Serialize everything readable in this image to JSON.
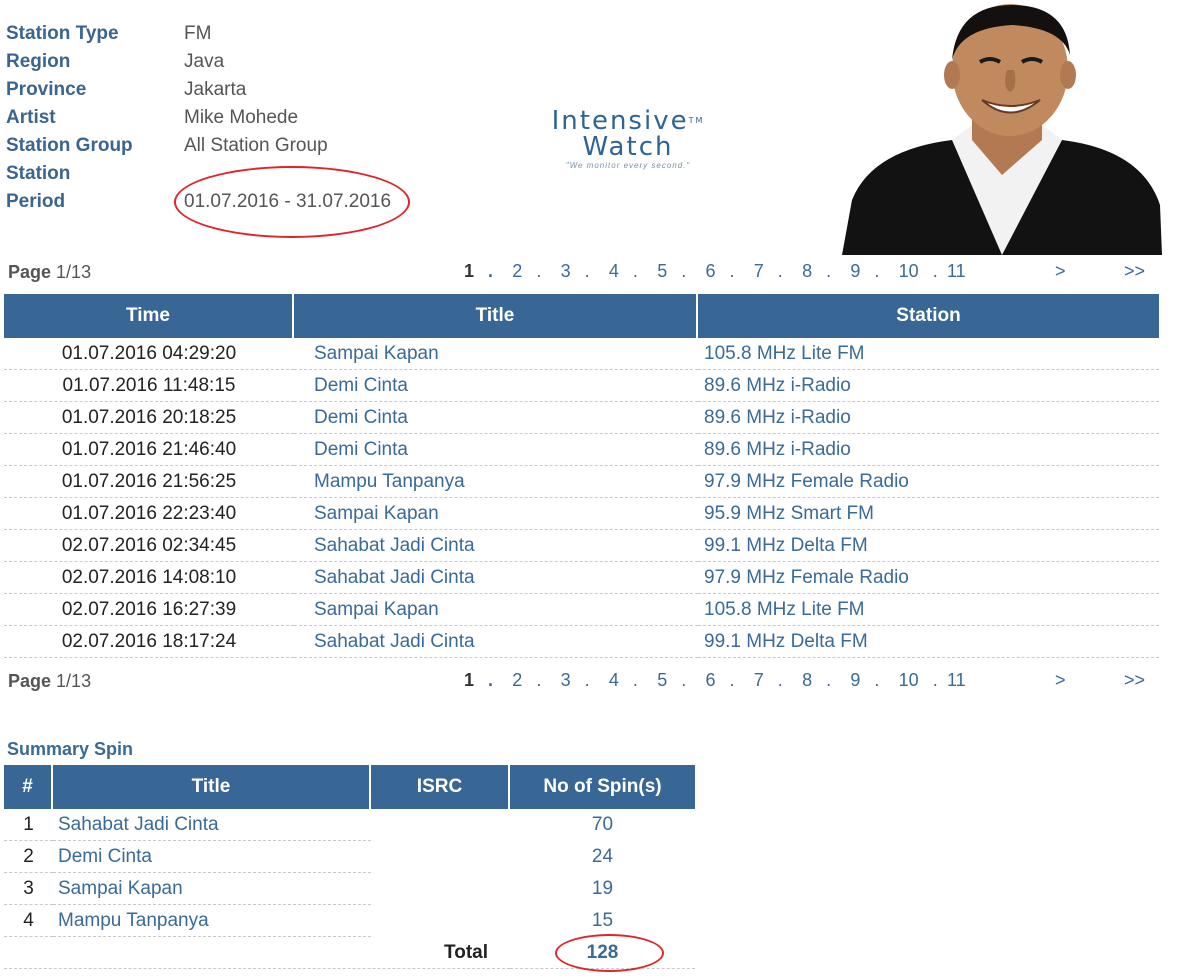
{
  "info": [
    {
      "label": "Station Type",
      "value": "FM"
    },
    {
      "label": "Region",
      "value": "Java"
    },
    {
      "label": "Province",
      "value": "Jakarta"
    },
    {
      "label": "Artist",
      "value": "Mike Mohede"
    },
    {
      "label": "Station Group",
      "value": "All Station Group"
    },
    {
      "label": "Station",
      "value": ""
    },
    {
      "label": "Period",
      "value": "01.07.2016 - 31.07.2016"
    }
  ],
  "logo": {
    "line1": "Intensive",
    "tm": "TM",
    "line2": "Watch",
    "tagline": "\"We monitor every second.\""
  },
  "pager": {
    "label": "Page",
    "current": "1/13",
    "pages": [
      "1",
      "2",
      "3",
      "4",
      "5",
      "6",
      "7",
      "8",
      "9",
      "10",
      "11"
    ],
    "separator": ".",
    "next": ">",
    "last": ">>"
  },
  "table": {
    "headers": [
      "Time",
      "Title",
      "Station"
    ],
    "rows": [
      {
        "time": "01.07.2016 04:29:20",
        "title": "Sampai Kapan",
        "station": "105.8 MHz Lite FM"
      },
      {
        "time": "01.07.2016 11:48:15",
        "title": "Demi Cinta",
        "station": "89.6 MHz i-Radio"
      },
      {
        "time": "01.07.2016 20:18:25",
        "title": "Demi Cinta",
        "station": "89.6 MHz i-Radio"
      },
      {
        "time": "01.07.2016 21:46:40",
        "title": "Demi Cinta",
        "station": "89.6 MHz i-Radio"
      },
      {
        "time": "01.07.2016 21:56:25",
        "title": "Mampu Tanpanya",
        "station": "97.9 MHz Female Radio"
      },
      {
        "time": "01.07.2016 22:23:40",
        "title": "Sampai Kapan",
        "station": "95.9 MHz Smart FM"
      },
      {
        "time": "02.07.2016 02:34:45",
        "title": "Sahabat Jadi Cinta",
        "station": "99.1 MHz Delta FM"
      },
      {
        "time": "02.07.2016 14:08:10",
        "title": "Sahabat Jadi Cinta",
        "station": "97.9 MHz Female Radio"
      },
      {
        "time": "02.07.2016 16:27:39",
        "title": "Sampai Kapan",
        "station": "105.8 MHz Lite FM"
      },
      {
        "time": "02.07.2016 18:17:24",
        "title": "Sahabat Jadi Cinta",
        "station": "99.1 MHz Delta FM"
      }
    ]
  },
  "summary": {
    "title": "Summary Spin",
    "headers": [
      "#",
      "Title",
      "ISRC",
      "No of Spin(s)"
    ],
    "rows": [
      {
        "idx": "1",
        "title": "Sahabat Jadi Cinta",
        "isrc": "",
        "spins": "70"
      },
      {
        "idx": "2",
        "title": "Demi Cinta",
        "isrc": "",
        "spins": "24"
      },
      {
        "idx": "3",
        "title": "Sampai Kapan",
        "isrc": "",
        "spins": "19"
      },
      {
        "idx": "4",
        "title": "Mampu Tanpanya",
        "isrc": "",
        "spins": "15"
      }
    ],
    "total_label": "Total",
    "total_value": "128"
  },
  "colors": {
    "header_bg": "#396795",
    "link": "#3a6a98",
    "label": "#3a6590",
    "highlight_ring": "#e0242b"
  }
}
